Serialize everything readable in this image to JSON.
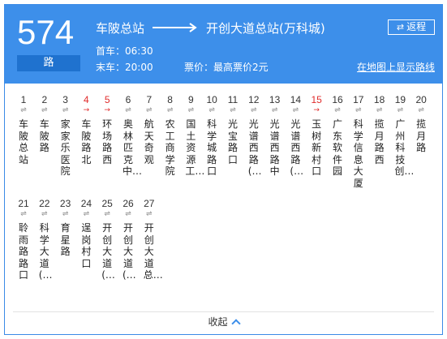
{
  "route": {
    "number": "574",
    "suffix": "路",
    "origin": "车陂总站",
    "destination": "开创大道总站(万科城)",
    "first_bus": "首车：06:30",
    "last_bus": "末车：20:00",
    "fare": "票价：最高票价2元",
    "return_label": "返程",
    "map_link": "在地图上显示路线",
    "colors": {
      "header": "#3d8fea",
      "active_stop": "#e02b2b"
    }
  },
  "stops": [
    {
      "num": "1",
      "arrow": "⇌",
      "name": "车陂总站",
      "active": false
    },
    {
      "num": "2",
      "arrow": "⇌",
      "name": "车陂路",
      "active": false
    },
    {
      "num": "3",
      "arrow": "⇌",
      "name": "家家乐医院",
      "active": false
    },
    {
      "num": "4",
      "arrow": "→",
      "name": "车陂路北",
      "active": true
    },
    {
      "num": "5",
      "arrow": "→",
      "name": "环场路西",
      "active": true
    },
    {
      "num": "6",
      "arrow": "⇌",
      "name": "奥林匹克中…",
      "active": false
    },
    {
      "num": "7",
      "arrow": "⇌",
      "name": "航天奇观",
      "active": false
    },
    {
      "num": "8",
      "arrow": "⇌",
      "name": "农工商学院",
      "active": false
    },
    {
      "num": "9",
      "arrow": "⇌",
      "name": "国土资源工…",
      "active": false
    },
    {
      "num": "10",
      "arrow": "⇌",
      "name": "科学城路口",
      "active": false
    },
    {
      "num": "11",
      "arrow": "⇌",
      "name": "光宝路口",
      "active": false
    },
    {
      "num": "12",
      "arrow": "⇌",
      "name": "光谱西路(…",
      "active": false
    },
    {
      "num": "13",
      "arrow": "⇌",
      "name": "光谱西路中",
      "active": false
    },
    {
      "num": "14",
      "arrow": "⇌",
      "name": "光谱西路(…",
      "active": false
    },
    {
      "num": "15",
      "arrow": "→",
      "name": "玉树新村口",
      "active": true
    },
    {
      "num": "16",
      "arrow": "⇌",
      "name": "广东软件园",
      "active": false
    },
    {
      "num": "17",
      "arrow": "⇌",
      "name": "科学信息大厦",
      "active": false
    },
    {
      "num": "18",
      "arrow": "⇌",
      "name": "揽月路西",
      "active": false
    },
    {
      "num": "19",
      "arrow": "⇌",
      "name": "广州科技创…",
      "active": false
    },
    {
      "num": "20",
      "arrow": "⇌",
      "name": "揽月路",
      "active": false
    },
    {
      "num": "21",
      "arrow": "⇌",
      "name": "聆雨路路口",
      "active": false
    },
    {
      "num": "22",
      "arrow": "⇌",
      "name": "科学大道(…",
      "active": false
    },
    {
      "num": "23",
      "arrow": "⇌",
      "name": "育星路",
      "active": false
    },
    {
      "num": "24",
      "arrow": "⇌",
      "name": "逞岗村口",
      "active": false
    },
    {
      "num": "25",
      "arrow": "⇌",
      "name": "开创大道(…",
      "active": false
    },
    {
      "num": "26",
      "arrow": "⇌",
      "name": "开创大道(…",
      "active": false
    },
    {
      "num": "27",
      "arrow": "⇌",
      "name": "开创大道总…",
      "active": false
    }
  ],
  "footer": {
    "collapse_label": "收起"
  }
}
